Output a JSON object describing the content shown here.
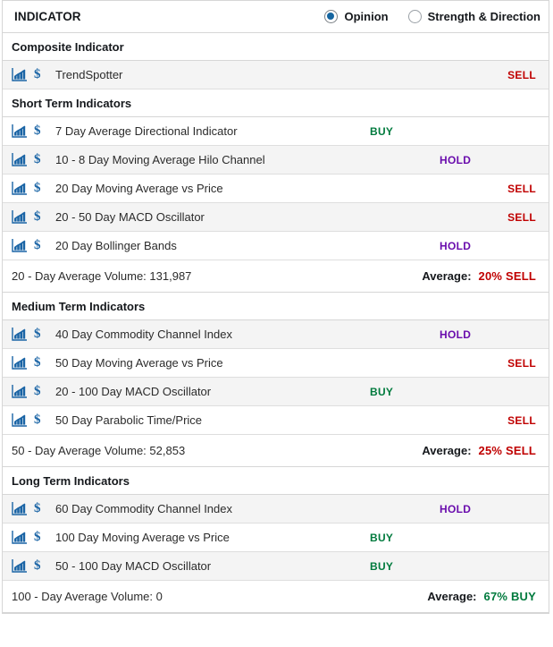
{
  "header": {
    "title": "INDICATOR",
    "options": [
      {
        "label": "Opinion",
        "selected": true
      },
      {
        "label": "Strength & Direction",
        "selected": false
      }
    ]
  },
  "icons": {
    "chart": "line-chart-icon",
    "dollar": "$"
  },
  "colors": {
    "buy": "#007a3d",
    "sell": "#c00000",
    "hold": "#6a0dad",
    "accent": "#1565a0",
    "row_alt": "#f4f4f4",
    "border": "#d6d6d6"
  },
  "sections": [
    {
      "title": "Composite Indicator",
      "rows": [
        {
          "name": "TrendSpotter",
          "verdict": "SELL",
          "verdict_type": "sell"
        }
      ]
    },
    {
      "title": "Short Term Indicators",
      "rows": [
        {
          "name": "7 Day Average Directional Indicator",
          "verdict": "BUY",
          "verdict_type": "buy"
        },
        {
          "name": "10 - 8 Day Moving Average Hilo Channel",
          "verdict": "HOLD",
          "verdict_type": "hold"
        },
        {
          "name": "20 Day Moving Average vs Price",
          "verdict": "SELL",
          "verdict_type": "sell"
        },
        {
          "name": "20 - 50 Day MACD Oscillator",
          "verdict": "SELL",
          "verdict_type": "sell"
        },
        {
          "name": "20 Day Bollinger Bands",
          "verdict": "HOLD",
          "verdict_type": "hold"
        }
      ],
      "summary": {
        "volume_label": "20 - Day Average Volume: 131,987",
        "average_label": "Average:",
        "average_value": "20% SELL",
        "average_type": "sell"
      }
    },
    {
      "title": "Medium Term Indicators",
      "rows": [
        {
          "name": "40 Day Commodity Channel Index",
          "verdict": "HOLD",
          "verdict_type": "hold"
        },
        {
          "name": "50 Day Moving Average vs Price",
          "verdict": "SELL",
          "verdict_type": "sell"
        },
        {
          "name": "20 - 100 Day MACD Oscillator",
          "verdict": "BUY",
          "verdict_type": "buy"
        },
        {
          "name": "50 Day Parabolic Time/Price",
          "verdict": "SELL",
          "verdict_type": "sell"
        }
      ],
      "summary": {
        "volume_label": "50 - Day Average Volume: 52,853",
        "average_label": "Average:",
        "average_value": "25% SELL",
        "average_type": "sell"
      }
    },
    {
      "title": "Long Term Indicators",
      "rows": [
        {
          "name": "60 Day Commodity Channel Index",
          "verdict": "HOLD",
          "verdict_type": "hold"
        },
        {
          "name": "100 Day Moving Average vs Price",
          "verdict": "BUY",
          "verdict_type": "buy"
        },
        {
          "name": "50 - 100 Day MACD Oscillator",
          "verdict": "BUY",
          "verdict_type": "buy"
        }
      ],
      "summary": {
        "volume_label": "100 - Day Average Volume: 0",
        "average_label": "Average:",
        "average_value": "67% BUY",
        "average_type": "buy"
      }
    }
  ]
}
